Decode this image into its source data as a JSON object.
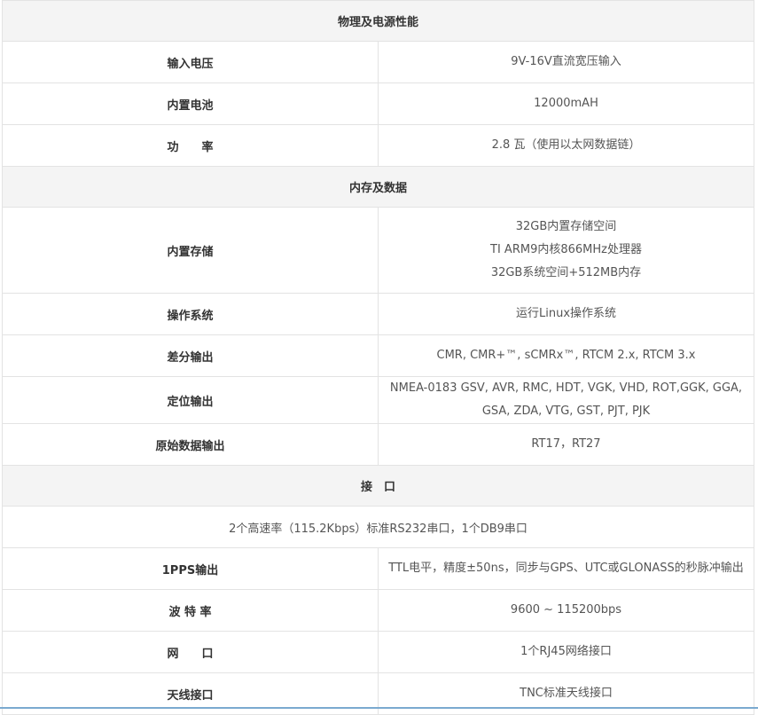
{
  "sections": {
    "physical_power": "物理及电源性能",
    "memory_data": "内存及数据",
    "interface": "接　口"
  },
  "rows": {
    "input_voltage": {
      "label": "输入电压",
      "value": "9V-16V直流宽压输入"
    },
    "battery": {
      "label": "内置电池",
      "value": "12000mAH"
    },
    "power": {
      "label": "功　　率",
      "value": "2.8 瓦（使用以太网数据链）"
    },
    "storage": {
      "label": "内置存储",
      "lines": [
        "32GB内置存储空间",
        "TI ARM9内核866MHz处理器",
        "32GB系统空间+512MB内存"
      ]
    },
    "os": {
      "label": "操作系统",
      "value": "运行Linux操作系统"
    },
    "diff_output": {
      "label": "差分输出",
      "value": "CMR, CMR+™, sCMRx™, RTCM 2.x, RTCM 3.x"
    },
    "positioning": {
      "label": "定位输出",
      "value": "NMEA-0183 GSV, AVR, RMC, HDT, VGK, VHD, ROT,GGK, GGA, GSA, ZDA, VTG, GST, PJT, PJK"
    },
    "raw_output": {
      "label": "原始数据输出",
      "value": "RT17，RT27"
    },
    "serial": {
      "value": "2个高速率（115.2Kbps）标准RS232串口，1个DB9串口"
    },
    "pps": {
      "label": "1PPS输出",
      "value": "TTL电平，精度±50ns，同步与GPS、UTC或GLONASS的秒脉冲输出"
    },
    "baud": {
      "label": "波 特 率",
      "value": "9600 ~ 115200bps"
    },
    "network": {
      "label": "网　　口",
      "value": "1个RJ45网络接口"
    },
    "antenna": {
      "label": "天线接口",
      "value": "TNC标准天线接口"
    }
  }
}
